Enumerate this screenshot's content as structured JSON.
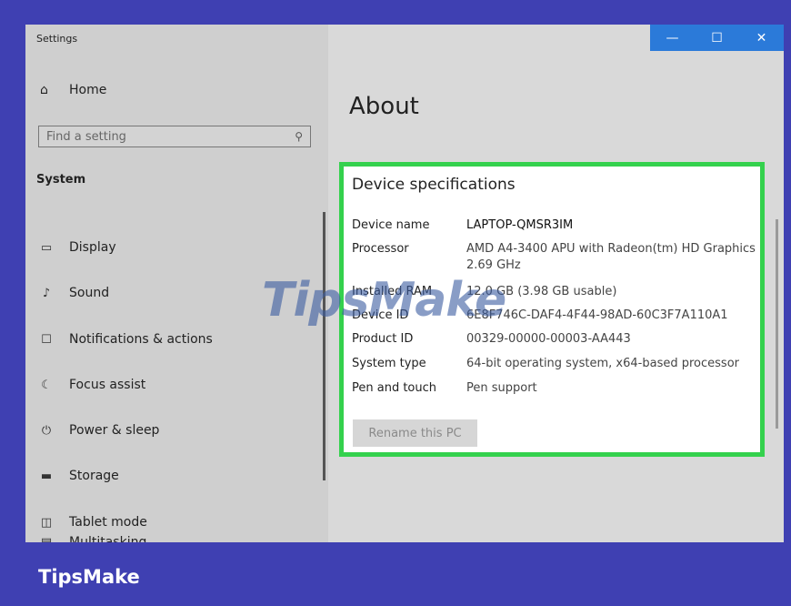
{
  "window": {
    "title": "Settings",
    "controls": {
      "minimize": "—",
      "maximize": "☐",
      "close": "✕"
    }
  },
  "sidebar": {
    "home_label": "Home",
    "home_icon": "home-icon",
    "search_placeholder": "Find a setting",
    "section_title": "System",
    "items": [
      {
        "label": "Display",
        "icon": "display-icon"
      },
      {
        "label": "Sound",
        "icon": "sound-icon"
      },
      {
        "label": "Notifications & actions",
        "icon": "notifications-icon"
      },
      {
        "label": "Focus assist",
        "icon": "focus-assist-icon"
      },
      {
        "label": "Power & sleep",
        "icon": "power-icon"
      },
      {
        "label": "Storage",
        "icon": "storage-icon"
      },
      {
        "label": "Tablet mode",
        "icon": "tablet-mode-icon"
      },
      {
        "label": "Multitasking",
        "icon": "multitasking-icon"
      }
    ]
  },
  "main": {
    "page_title": "About",
    "device_specs": {
      "title": "Device specifications",
      "rows": [
        {
          "label": "Device name",
          "value": "LAPTOP-QMSR3IM"
        },
        {
          "label": "Processor",
          "value": "AMD A4-3400 APU with Radeon(tm) HD Graphics   2.69 GHz"
        },
        {
          "label": "Installed RAM",
          "value": "12.0 GB (3.98 GB usable)"
        },
        {
          "label": "Device ID",
          "value": "6E8F746C-DAF4-4F44-98AD-60C3F7A110A1"
        },
        {
          "label": "Product ID",
          "value": "00329-00000-00003-AA443"
        },
        {
          "label": "System type",
          "value": "64-bit operating system, x64-based processor"
        },
        {
          "label": "Pen and touch",
          "value": "Pen support"
        }
      ],
      "rename_button": "Rename this PC",
      "highlight_color": "#34d14d"
    }
  },
  "watermark": "TipsMake",
  "footer_brand": "TipsMake",
  "colors": {
    "accent": "#2b7ad9",
    "frame": "#3f40b2"
  }
}
